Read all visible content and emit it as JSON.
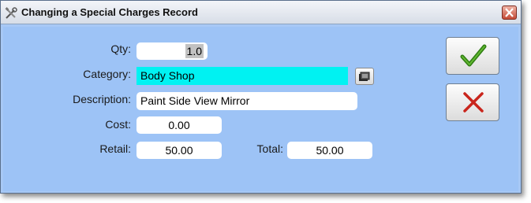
{
  "window": {
    "title": "Changing a Special Charges Record",
    "title_icon": "tools-icon",
    "close_icon": "close-icon"
  },
  "form": {
    "qty": {
      "label": "Qty:",
      "value": "1.0"
    },
    "category": {
      "label": "Category:",
      "value": "Body Shop",
      "browse_icon": "folder-icon"
    },
    "description": {
      "label": "Description:",
      "value": "Paint Side View Mirror"
    },
    "cost": {
      "label": "Cost:",
      "value": "0.00"
    },
    "retail": {
      "label": "Retail:",
      "value": "50.00"
    },
    "total": {
      "label": "Total:",
      "value": "50.00"
    }
  },
  "actions": {
    "ok_icon": "checkmark-icon",
    "cancel_icon": "x-icon"
  },
  "colors": {
    "background": "#9dc3f6",
    "category_highlight": "#00f2f2",
    "ok_green": "#3a8a18",
    "cancel_red": "#d32b22"
  }
}
